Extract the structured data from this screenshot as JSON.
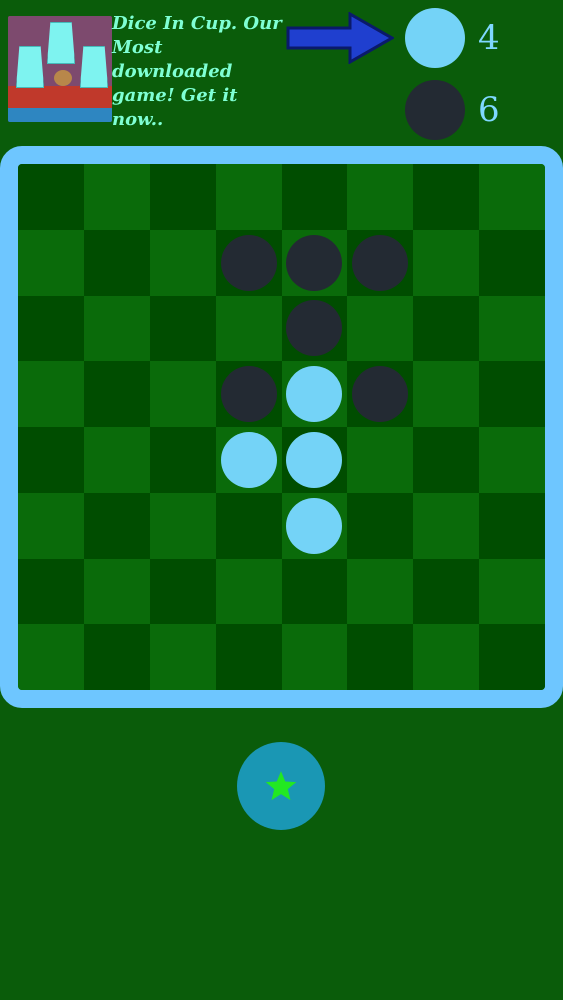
{
  "ad": {
    "thumbnail_icon": "dice-in-cup-thumbnail-icon",
    "text": "Dice In Cup. Our Most downloaded game! Get it now.."
  },
  "turn_indicator": {
    "arrow_icon": "arrow-right-icon",
    "arrow_color": "#1f3fcf"
  },
  "players": [
    {
      "id": "white",
      "color": "#74d3f7",
      "score": "4"
    },
    {
      "id": "black",
      "color": "#232a33",
      "score": "6"
    }
  ],
  "board": {
    "rows": 8,
    "cols": 8,
    "frame_color": "#6ec6ff",
    "cells": [
      [
        null,
        null,
        null,
        null,
        null,
        null,
        null,
        null
      ],
      [
        null,
        null,
        null,
        "black",
        "black",
        "black",
        null,
        null
      ],
      [
        null,
        null,
        null,
        null,
        "black",
        null,
        null,
        null
      ],
      [
        null,
        null,
        null,
        "black",
        "white",
        "black",
        null,
        null
      ],
      [
        null,
        null,
        null,
        "white",
        "white",
        null,
        null,
        null
      ],
      [
        null,
        null,
        null,
        null,
        "white",
        null,
        null,
        null
      ],
      [
        null,
        null,
        null,
        null,
        null,
        null,
        null,
        null
      ],
      [
        null,
        null,
        null,
        null,
        null,
        null,
        null,
        null
      ]
    ]
  },
  "star_button": {
    "icon": "star-icon",
    "color": "#22e822"
  }
}
